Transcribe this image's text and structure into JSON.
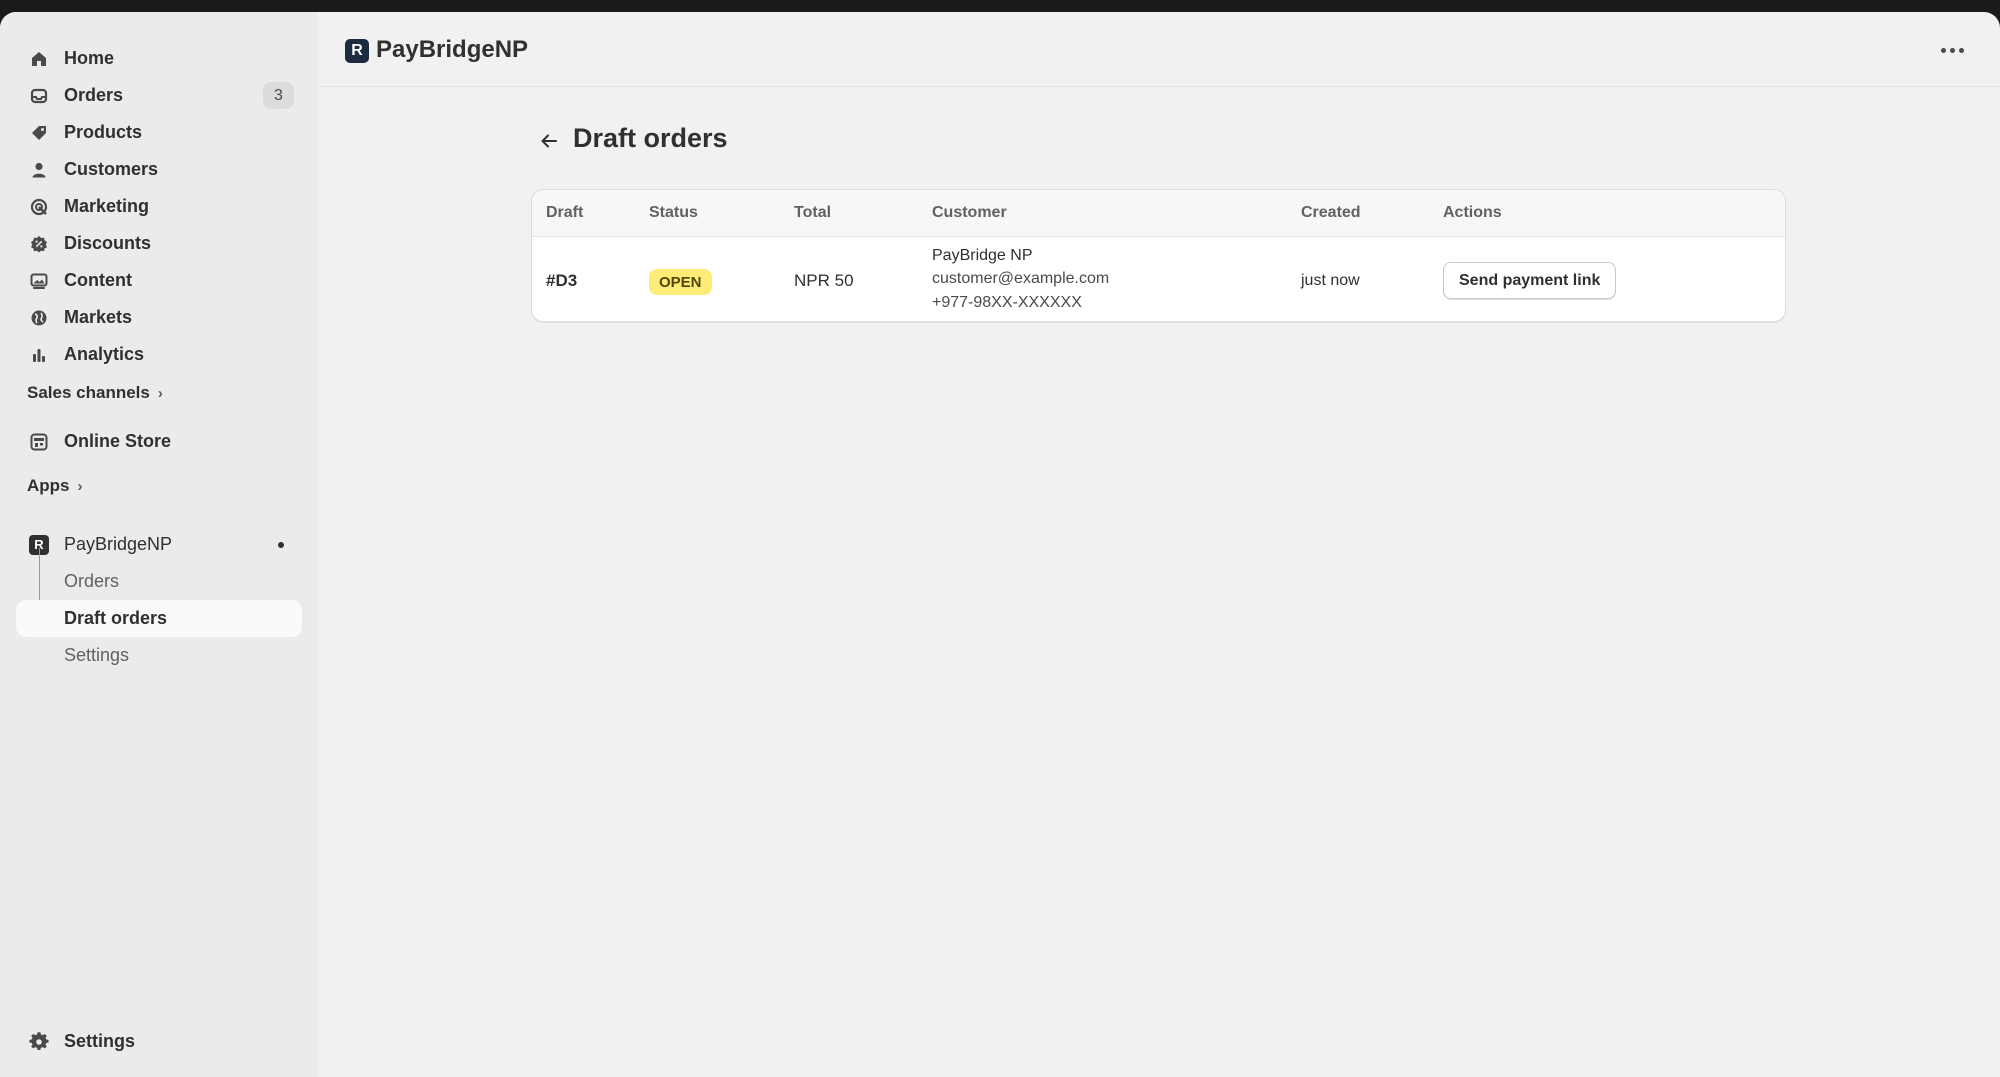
{
  "sidebar": {
    "items": [
      {
        "label": "Home",
        "icon": "home-icon"
      },
      {
        "label": "Orders",
        "icon": "inbox-icon",
        "count": "3"
      },
      {
        "label": "Products",
        "icon": "tag-icon"
      },
      {
        "label": "Customers",
        "icon": "person-icon"
      },
      {
        "label": "Marketing",
        "icon": "target-icon"
      },
      {
        "label": "Discounts",
        "icon": "discount-icon"
      },
      {
        "label": "Content",
        "icon": "image-icon"
      },
      {
        "label": "Markets",
        "icon": "globe-icon"
      },
      {
        "label": "Analytics",
        "icon": "bar-chart-icon"
      }
    ],
    "sales_channels": {
      "label": "Sales channels",
      "items": [
        {
          "label": "Online Store",
          "icon": "store-icon"
        }
      ]
    },
    "apps": {
      "label": "Apps"
    },
    "app": {
      "label": "PayBridgeNP",
      "logo_letter": "R",
      "sub_items": [
        {
          "label": "Orders"
        },
        {
          "label": "Draft orders",
          "active": true
        },
        {
          "label": "Settings"
        }
      ]
    },
    "settings": {
      "label": "Settings",
      "icon": "gear-icon"
    }
  },
  "topbar": {
    "title": "PayBridgeNP",
    "logo_letter": "R"
  },
  "main": {
    "title": "Draft orders",
    "table": {
      "columns": [
        "Draft",
        "Status",
        "Total",
        "Customer",
        "Created",
        "Actions"
      ],
      "rows": [
        {
          "draft": "#D3",
          "status": "OPEN",
          "total": "NPR 50",
          "customer_name": "PayBridge NP",
          "customer_email": "customer@example.com",
          "customer_phone": "+977-98XX-XXXXXX",
          "created": "just now",
          "action": "Send payment link"
        }
      ]
    }
  },
  "colors": {
    "status_open_bg": "#ffeb78",
    "app_logo": "#1c2b3d",
    "sidebar_bg": "#ebebeb",
    "page_bg": "#f1f1f1"
  }
}
